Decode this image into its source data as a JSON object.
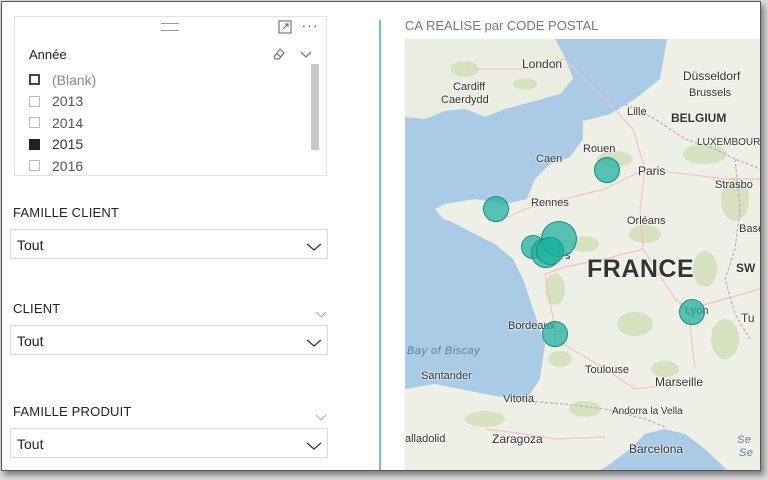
{
  "year_slicer": {
    "title": "Année",
    "items": [
      {
        "label": "(Blank)",
        "state": "blank"
      },
      {
        "label": "2013",
        "state": "unchecked"
      },
      {
        "label": "2014",
        "state": "unchecked"
      },
      {
        "label": "2015",
        "state": "checked"
      },
      {
        "label": "2016",
        "state": "unchecked"
      }
    ]
  },
  "filters": {
    "famille_client": {
      "label": "FAMILLE CLIENT",
      "value": "Tout"
    },
    "client": {
      "label": "CLIENT",
      "value": "Tout"
    },
    "famille_produit": {
      "label": "FAMILLE PRODUIT",
      "value": "Tout"
    }
  },
  "map": {
    "title": "CA REALISE par CODE POSTAL",
    "country_label": "FRANCE",
    "cities": {
      "london": "London",
      "cardiff": "Cardiff",
      "caerdydd": "Caerdydd",
      "dusseldorf": "Düsseldorf",
      "brussels": "Brussels",
      "lille": "Lille",
      "belgium": "BELGIUM",
      "luxembourg": "LUXEMBOURG",
      "rouen": "Rouen",
      "caen": "Caen",
      "paris": "Paris",
      "strasbourg": "Strasbo",
      "rennes": "Rennes",
      "orleans": "Orléans",
      "basel": "Base",
      "nantes": "s",
      "switzerland": "SW",
      "bordeaux": "Bordeaux",
      "lyon": "Lyon",
      "torino": "Tu",
      "santander": "Santander",
      "toulouse": "Toulouse",
      "marseille": "Marseille",
      "vitoria": "Vitoria",
      "andorra": "Andorra la Vella",
      "valladolid": "alladolid",
      "zaragoza": "Zaragoza",
      "barcelona": "Barcelona"
    },
    "seas": {
      "biscay": "Bay of Biscay",
      "med_1": "Se",
      "med_2": "Se"
    },
    "bubble_color": "#20b2a0"
  }
}
